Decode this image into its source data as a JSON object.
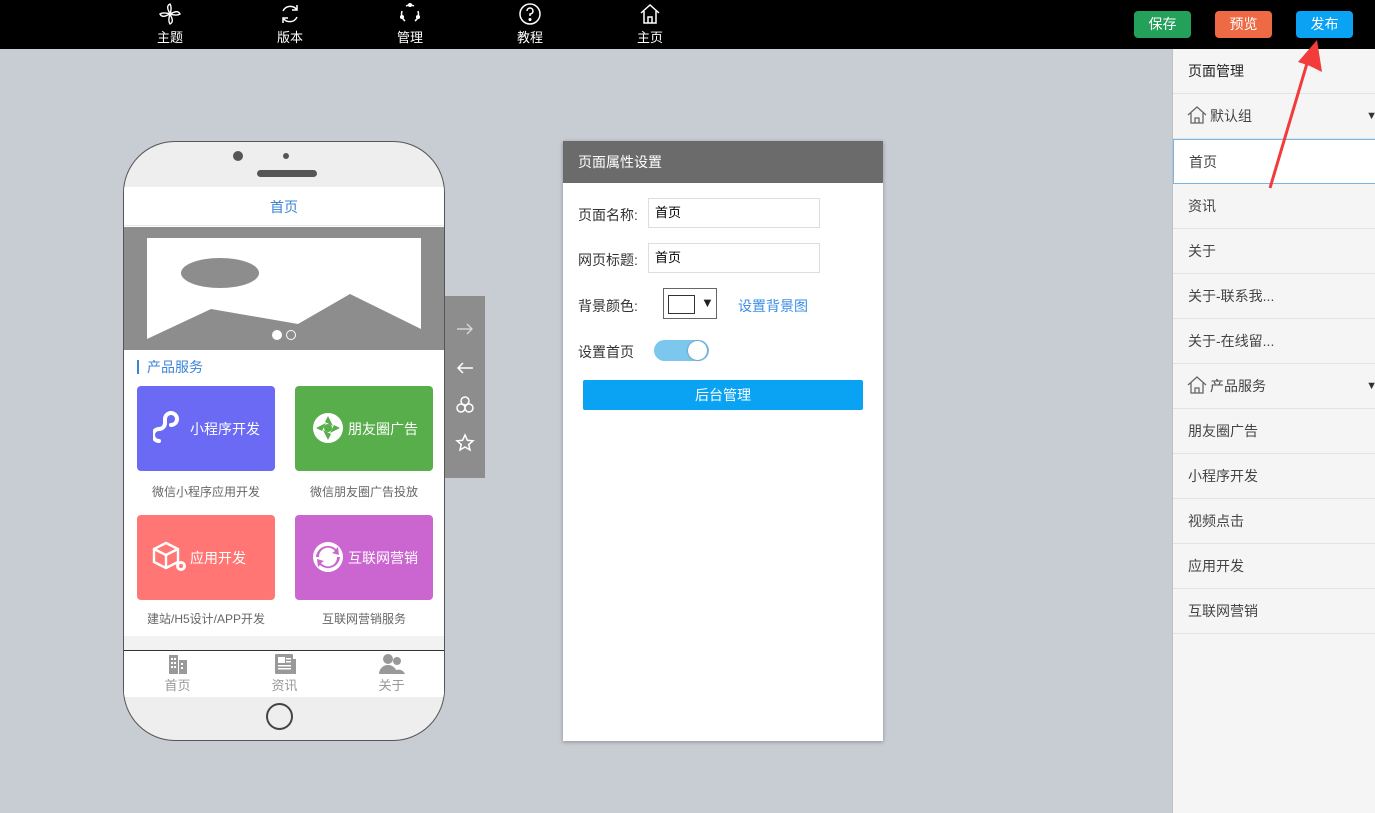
{
  "topnav": {
    "items": [
      {
        "label": "主题",
        "icon": "pinwheel-icon"
      },
      {
        "label": "版本",
        "icon": "refresh-icon"
      },
      {
        "label": "管理",
        "icon": "dotted-circle-icon"
      },
      {
        "label": "教程",
        "icon": "help-icon"
      },
      {
        "label": "主页",
        "icon": "home-icon"
      }
    ],
    "save_label": "保存",
    "preview_label": "预览",
    "publish_label": "发布"
  },
  "colors": {
    "save": "#23a05a",
    "preview": "#ee6a45",
    "publish": "#0aa3f4",
    "card_miniprogram": "#6a6af5",
    "card_moments": "#58ae4b",
    "card_app": "#ff7675",
    "card_marketing": "#cb66d0",
    "accent": "#3b83d6"
  },
  "phone": {
    "page_title": "首页",
    "section_title": "产品服务",
    "cards": [
      {
        "label": "小程序开发",
        "caption": "微信小程序应用开发",
        "icon": "miniprogram-icon"
      },
      {
        "label": "朋友圈广告",
        "caption": "微信朋友圈广告投放",
        "icon": "aperture-icon"
      },
      {
        "label": "应用开发",
        "caption": "建站/H5设计/APP开发",
        "icon": "cube-gear-icon"
      },
      {
        "label": "互联网营销",
        "caption": "互联网营销服务",
        "icon": "cycle-arrows-icon"
      }
    ],
    "tabs": [
      {
        "label": "首页",
        "icon": "building-icon"
      },
      {
        "label": "资讯",
        "icon": "newspaper-icon"
      },
      {
        "label": "关于",
        "icon": "users-icon"
      }
    ]
  },
  "sidetools": [
    "arrow-right-icon",
    "arrow-left-icon",
    "layers-icon",
    "star-icon"
  ],
  "props": {
    "header": "页面属性设置",
    "name_label": "页面名称:",
    "name_value": "首页",
    "title_label": "网页标题:",
    "title_value": "首页",
    "bgcolor_label": "背景颜色:",
    "bg_link": "设置背景图",
    "homepage_label": "设置首页",
    "homepage_on": true,
    "admin_button": "后台管理"
  },
  "page_manager": {
    "title": "页面管理",
    "items": [
      {
        "label": "默认组",
        "type": "group"
      },
      {
        "label": "首页",
        "type": "page",
        "active": true
      },
      {
        "label": "资讯",
        "type": "page"
      },
      {
        "label": "关于",
        "type": "page"
      },
      {
        "label": "关于-联系我...",
        "type": "page"
      },
      {
        "label": "关于-在线留...",
        "type": "page"
      },
      {
        "label": "产品服务",
        "type": "group"
      },
      {
        "label": "朋友圈广告",
        "type": "page"
      },
      {
        "label": "小程序开发",
        "type": "page"
      },
      {
        "label": "视频点击",
        "type": "page"
      },
      {
        "label": "应用开发",
        "type": "page"
      },
      {
        "label": "互联网营销",
        "type": "page"
      }
    ]
  }
}
